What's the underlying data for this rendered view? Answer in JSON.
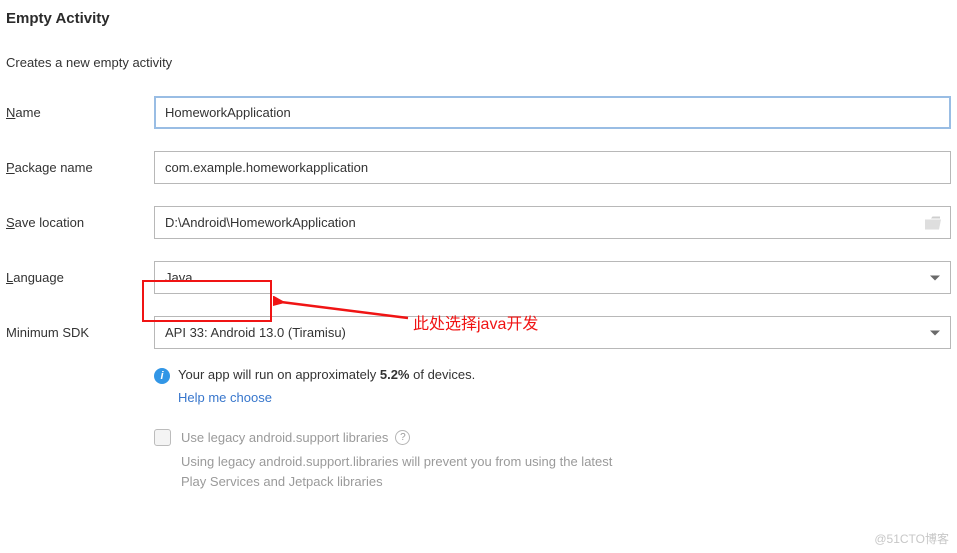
{
  "header": {
    "title": "Empty Activity",
    "subtitle": "Creates a new empty activity"
  },
  "fields": {
    "name": {
      "label_u": "N",
      "label_rest": "ame",
      "value": "HomeworkApplication"
    },
    "package": {
      "label_u": "P",
      "label_rest": "ackage name",
      "value": "com.example.homeworkapplication"
    },
    "save": {
      "label_u": "S",
      "label_rest": "ave location",
      "value": "D:\\Android\\HomeworkApplication"
    },
    "language": {
      "label_u": "L",
      "label_rest": "anguage",
      "value": "Java"
    },
    "minsdk": {
      "label": "Minimum SDK",
      "value": "API 33: Android 13.0 (Tiramisu)"
    }
  },
  "info": {
    "prefix": "Your app will run on approximately ",
    "percent": "5.2%",
    "suffix": " of devices.",
    "help": "Help me choose"
  },
  "legacy": {
    "label": "Use legacy android.support libraries",
    "desc": "Using legacy android.support.libraries will prevent you from using the latest Play Services and Jetpack libraries"
  },
  "annotation": {
    "text": "此处选择java开发"
  },
  "watermark": "@51CTO博客"
}
